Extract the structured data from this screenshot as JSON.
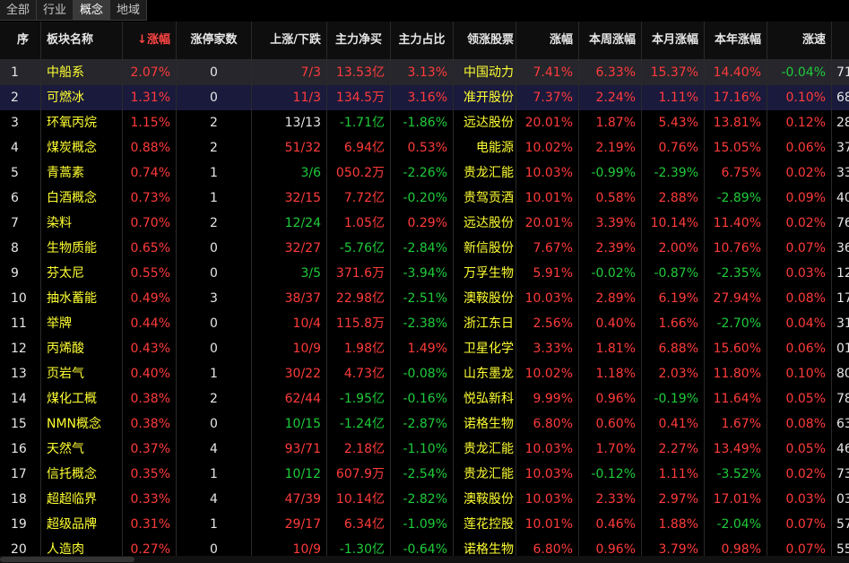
{
  "tabs": [
    {
      "label": "全部",
      "active": false
    },
    {
      "label": "行业",
      "active": false
    },
    {
      "label": "概念",
      "active": true
    },
    {
      "label": "地域",
      "active": false
    }
  ],
  "columns": [
    "序",
    "板块名称",
    "涨幅",
    "涨停家数",
    "上涨/下跌",
    "主力净买",
    "主力占比",
    "领涨股票",
    "涨幅",
    "本周涨幅",
    "本月涨幅",
    "本年涨幅",
    "涨速",
    ""
  ],
  "header_sort_prefix": "↓",
  "colors": {
    "up": "#ff3b3b",
    "down": "#1fcc3b",
    "flat": "#e6e6e6",
    "name": "#ffff33"
  },
  "rows": [
    {
      "idx": "1",
      "name": "中船系",
      "chg": "2.07%",
      "limit": "0",
      "updown": "7/3",
      "net": "13.53亿",
      "ratio": "3.13%",
      "leader": "中国动力",
      "lchg": "7.41%",
      "week": "6.33%",
      "month": "15.37%",
      "year": "14.40%",
      "speed": "-0.04%",
      "extra": "71"
    },
    {
      "idx": "2",
      "name": "可燃冰",
      "chg": "1.31%",
      "limit": "0",
      "updown": "11/3",
      "net": "134.5万",
      "ratio": "3.16%",
      "leader": "准开股份",
      "lchg": "7.37%",
      "week": "2.24%",
      "month": "1.11%",
      "year": "17.16%",
      "speed": "0.10%",
      "extra": "68"
    },
    {
      "idx": "3",
      "name": "环氧丙烷",
      "chg": "1.15%",
      "limit": "2",
      "updown": "13/13",
      "net": "-1.71亿",
      "ratio": "-1.86%",
      "leader": "远达股份",
      "lchg": "20.01%",
      "week": "1.87%",
      "month": "5.43%",
      "year": "13.81%",
      "speed": "0.12%",
      "extra": "28"
    },
    {
      "idx": "4",
      "name": "煤炭概念",
      "chg": "0.88%",
      "limit": "2",
      "updown": "51/32",
      "net": "6.94亿",
      "ratio": "0.53%",
      "leader": "电能源",
      "lchg": "10.02%",
      "week": "2.19%",
      "month": "0.76%",
      "year": "15.05%",
      "speed": "0.06%",
      "extra": "37"
    },
    {
      "idx": "5",
      "name": "青蒿素",
      "chg": "0.74%",
      "limit": "1",
      "updown": "3/6",
      "net": "050.2万",
      "ratio": "-2.26%",
      "leader": "贵龙汇能",
      "lchg": "10.03%",
      "week": "-0.99%",
      "month": "-2.39%",
      "year": "6.75%",
      "speed": "0.02%",
      "extra": "33"
    },
    {
      "idx": "6",
      "name": "白酒概念",
      "chg": "0.73%",
      "limit": "1",
      "updown": "32/15",
      "net": "7.72亿",
      "ratio": "-0.20%",
      "leader": "贵驾贡酒",
      "lchg": "10.01%",
      "week": "0.58%",
      "month": "2.88%",
      "year": "-2.89%",
      "speed": "0.09%",
      "extra": "40"
    },
    {
      "idx": "7",
      "name": "染料",
      "chg": "0.70%",
      "limit": "2",
      "updown": "12/24",
      "net": "1.05亿",
      "ratio": "0.29%",
      "leader": "远达股份",
      "lchg": "20.01%",
      "week": "3.39%",
      "month": "10.14%",
      "year": "11.40%",
      "speed": "0.02%",
      "extra": "76"
    },
    {
      "idx": "8",
      "name": "生物质能",
      "chg": "0.65%",
      "limit": "0",
      "updown": "32/27",
      "net": "-5.76亿",
      "ratio": "-2.84%",
      "leader": "新信股份",
      "lchg": "7.67%",
      "week": "2.39%",
      "month": "2.00%",
      "year": "10.76%",
      "speed": "0.07%",
      "extra": "36"
    },
    {
      "idx": "9",
      "name": "芬太尼",
      "chg": "0.55%",
      "limit": "0",
      "updown": "3/5",
      "net": "371.6万",
      "ratio": "-3.94%",
      "leader": "万孚生物",
      "lchg": "5.91%",
      "week": "-0.02%",
      "month": "-0.87%",
      "year": "-2.35%",
      "speed": "0.03%",
      "extra": "12"
    },
    {
      "idx": "10",
      "name": "抽水蓄能",
      "chg": "0.49%",
      "limit": "3",
      "updown": "38/37",
      "net": "22.98亿",
      "ratio": "-2.51%",
      "leader": "澳鞍股份",
      "lchg": "10.03%",
      "week": "2.89%",
      "month": "6.19%",
      "year": "27.94%",
      "speed": "0.08%",
      "extra": "17"
    },
    {
      "idx": "11",
      "name": "举牌",
      "chg": "0.44%",
      "limit": "0",
      "updown": "10/4",
      "net": "115.8万",
      "ratio": "-2.38%",
      "leader": "浙江东日",
      "lchg": "2.56%",
      "week": "0.40%",
      "month": "1.66%",
      "year": "-2.70%",
      "speed": "0.04%",
      "extra": "31"
    },
    {
      "idx": "12",
      "name": "丙烯酸",
      "chg": "0.43%",
      "limit": "0",
      "updown": "10/9",
      "net": "1.98亿",
      "ratio": "1.49%",
      "leader": "卫星化学",
      "lchg": "3.33%",
      "week": "1.81%",
      "month": "6.88%",
      "year": "15.60%",
      "speed": "0.06%",
      "extra": "01"
    },
    {
      "idx": "13",
      "name": "页岩气",
      "chg": "0.40%",
      "limit": "1",
      "updown": "30/22",
      "net": "4.73亿",
      "ratio": "-0.08%",
      "leader": "山东墨龙",
      "lchg": "10.02%",
      "week": "1.18%",
      "month": "2.03%",
      "year": "11.80%",
      "speed": "0.10%",
      "extra": "80"
    },
    {
      "idx": "14",
      "name": "煤化工概",
      "chg": "0.38%",
      "limit": "2",
      "updown": "62/44",
      "net": "-1.95亿",
      "ratio": "-0.16%",
      "leader": "悦弘新科",
      "lchg": "9.99%",
      "week": "0.96%",
      "month": "-0.19%",
      "year": "11.64%",
      "speed": "0.05%",
      "extra": "78"
    },
    {
      "idx": "15",
      "name": "NMN概念",
      "chg": "0.38%",
      "limit": "0",
      "updown": "10/15",
      "net": "-1.24亿",
      "ratio": "-2.87%",
      "leader": "诺格生物",
      "lchg": "6.80%",
      "week": "0.60%",
      "month": "0.41%",
      "year": "1.67%",
      "speed": "0.08%",
      "extra": "63"
    },
    {
      "idx": "16",
      "name": "天然气",
      "chg": "0.37%",
      "limit": "4",
      "updown": "93/71",
      "net": "2.18亿",
      "ratio": "-1.10%",
      "leader": "贵龙汇能",
      "lchg": "10.03%",
      "week": "1.70%",
      "month": "2.27%",
      "year": "13.49%",
      "speed": "0.05%",
      "extra": "46"
    },
    {
      "idx": "17",
      "name": "信托概念",
      "chg": "0.35%",
      "limit": "1",
      "updown": "10/12",
      "net": "607.9万",
      "ratio": "-2.54%",
      "leader": "贵龙汇能",
      "lchg": "10.03%",
      "week": "-0.12%",
      "month": "1.11%",
      "year": "-3.52%",
      "speed": "0.02%",
      "extra": "73"
    },
    {
      "idx": "18",
      "name": "超超临界",
      "chg": "0.33%",
      "limit": "4",
      "updown": "47/39",
      "net": "10.14亿",
      "ratio": "-2.82%",
      "leader": "澳鞍股份",
      "lchg": "10.03%",
      "week": "2.33%",
      "month": "2.97%",
      "year": "17.01%",
      "speed": "0.03%",
      "extra": "03"
    },
    {
      "idx": "19",
      "name": "超级品牌",
      "chg": "0.31%",
      "limit": "1",
      "updown": "29/17",
      "net": "6.34亿",
      "ratio": "-1.09%",
      "leader": "莲花控股",
      "lchg": "10.01%",
      "week": "0.46%",
      "month": "1.88%",
      "year": "-2.04%",
      "speed": "0.07%",
      "extra": "57"
    },
    {
      "idx": "20",
      "name": "人造肉",
      "chg": "0.27%",
      "limit": "0",
      "updown": "10/9",
      "net": "-1.30亿",
      "ratio": "-0.64%",
      "leader": "诺格生物",
      "lchg": "6.80%",
      "week": "0.96%",
      "month": "3.79%",
      "year": "0.98%",
      "speed": "0.07%",
      "extra": "55"
    }
  ]
}
